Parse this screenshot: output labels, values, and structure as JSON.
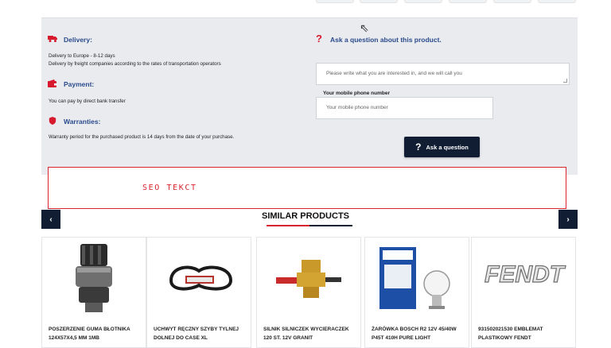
{
  "info": {
    "delivery_title": "Delivery:",
    "delivery_line1": "Delivery to Europe - 8-12 days",
    "delivery_line2": "Delivery by freight companies according to the rates of transportation operators",
    "payment_title": "Payment:",
    "payment_text": "You can pay by direct bank transfer",
    "warranties_title": "Warranties:",
    "warranties_text": "Warranty period for the purchased product is 14 days from the date of your purchase."
  },
  "question_form": {
    "title": "Ask a question about this product.",
    "message_placeholder": "Please write what you are interested in, and we will call you",
    "phone_label": "Your mobile phone number",
    "phone_placeholder": "Your mobile phone number",
    "submit_label": "Ask a question"
  },
  "seo": {
    "text": "SEO  TEKCT"
  },
  "similar": {
    "title": "SIMILAR PRODUCTS",
    "prev": "‹",
    "next": "›",
    "products": [
      {
        "name": "POSZERZENIE GUMA BŁOTNIKA 124X57X4,5 MM 1MB"
      },
      {
        "name": "UCHWYT RĘCZNY SZYBY TYLNEJ DOLNEJ DO CASE XL"
      },
      {
        "name": "SILNIK SILNICZEK WYCIERACZEK 120 ST. 12V GRANIT"
      },
      {
        "name": "ŻARÓWKA BOSCH R2 12V 45/40W P45T 410H PURE LIGHT"
      },
      {
        "name": "931502021530 EMBLEMAT PLASTIKOWY FENDT"
      }
    ]
  },
  "colors": {
    "accent_red": "#d9232e",
    "navy": "#111d33",
    "link_blue": "#2b4b8c"
  },
  "icons": [
    "truck-icon",
    "wallet-icon",
    "shield-icon",
    "question-icon",
    "chevron-left-icon",
    "chevron-right-icon"
  ]
}
